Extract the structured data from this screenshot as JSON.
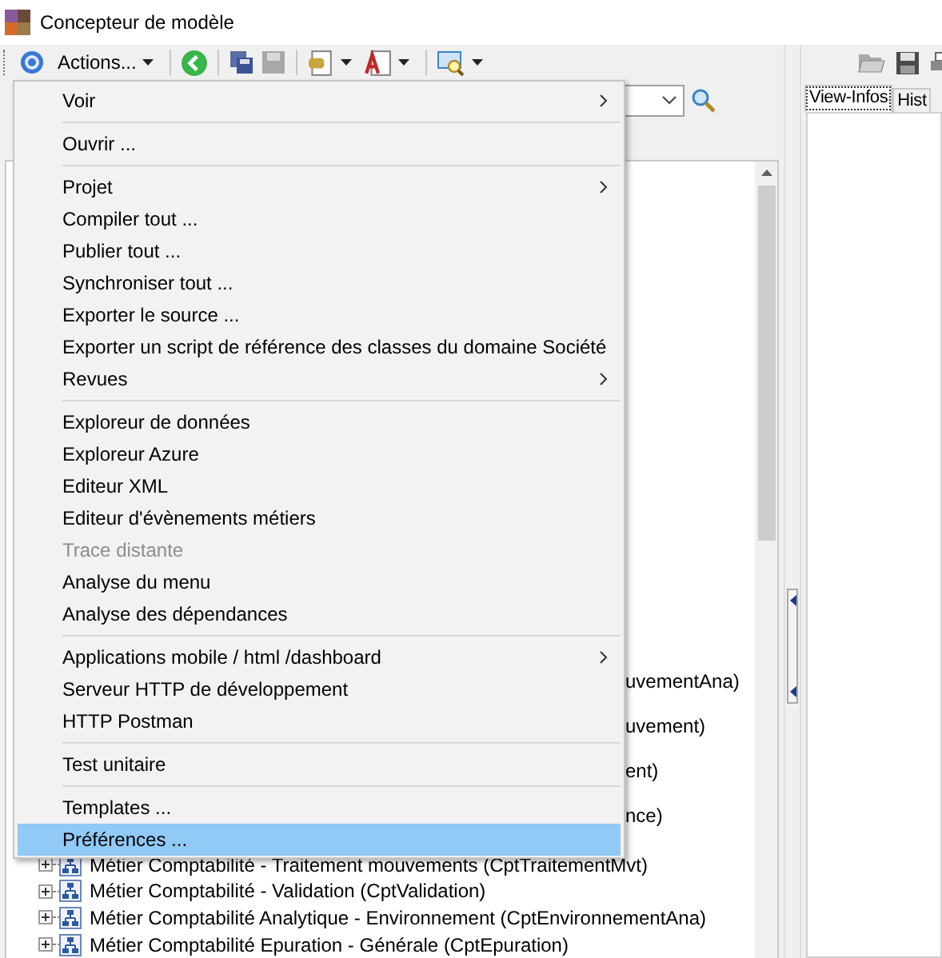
{
  "window": {
    "title": "Concepteur de modèle"
  },
  "toolbar": {
    "actions_label": "Actions..."
  },
  "tree": {
    "fragments": [
      {
        "label": "uvementAna)"
      },
      {
        "label": "uvement)"
      },
      {
        "label": "ent)"
      },
      {
        "label": "nce)"
      }
    ],
    "nodes": [
      {
        "label": "Métier Comptabilité - Traitement mouvements (CptTraitementMvt)"
      },
      {
        "label": "Métier Comptabilité - Validation (CptValidation)"
      },
      {
        "label": "Métier Comptabilité Analytique - Environnement (CptEnvironnementAna)"
      },
      {
        "label": "Métier Comptabilité Epuration - Générale (CptEpuration)"
      }
    ]
  },
  "side_panel": {
    "tabs": [
      {
        "label": "View-Infos",
        "selected": true
      },
      {
        "label": "Hist",
        "selected": false
      }
    ]
  },
  "menu": {
    "items": [
      {
        "kind": "item",
        "label": "Voir",
        "submenu": true,
        "disabled": false,
        "selected": false
      },
      {
        "kind": "separator"
      },
      {
        "kind": "item",
        "label": "Ouvrir ...",
        "submenu": false,
        "disabled": false,
        "selected": false
      },
      {
        "kind": "separator"
      },
      {
        "kind": "item",
        "label": "Projet",
        "submenu": true,
        "disabled": false,
        "selected": false
      },
      {
        "kind": "item",
        "label": "Compiler tout ...",
        "submenu": false,
        "disabled": false,
        "selected": false
      },
      {
        "kind": "item",
        "label": "Publier tout ...",
        "submenu": false,
        "disabled": false,
        "selected": false
      },
      {
        "kind": "item",
        "label": "Synchroniser tout ...",
        "submenu": false,
        "disabled": false,
        "selected": false
      },
      {
        "kind": "item",
        "label": "Exporter le source ...",
        "submenu": false,
        "disabled": false,
        "selected": false
      },
      {
        "kind": "item",
        "label": "Exporter un script de référence des classes du domaine Société",
        "submenu": false,
        "disabled": false,
        "selected": false
      },
      {
        "kind": "item",
        "label": "Revues",
        "submenu": true,
        "disabled": false,
        "selected": false
      },
      {
        "kind": "separator"
      },
      {
        "kind": "item",
        "label": "Exploreur de données",
        "submenu": false,
        "disabled": false,
        "selected": false
      },
      {
        "kind": "item",
        "label": "Exploreur Azure",
        "submenu": false,
        "disabled": false,
        "selected": false
      },
      {
        "kind": "item",
        "label": "Editeur XML",
        "submenu": false,
        "disabled": false,
        "selected": false
      },
      {
        "kind": "item",
        "label": "Editeur d'évènements métiers",
        "submenu": false,
        "disabled": false,
        "selected": false
      },
      {
        "kind": "item",
        "label": "Trace distante",
        "submenu": false,
        "disabled": true,
        "selected": false
      },
      {
        "kind": "item",
        "label": "Analyse du menu",
        "submenu": false,
        "disabled": false,
        "selected": false
      },
      {
        "kind": "item",
        "label": "Analyse des dépendances",
        "submenu": false,
        "disabled": false,
        "selected": false
      },
      {
        "kind": "separator"
      },
      {
        "kind": "item",
        "label": "Applications mobile / html /dashboard",
        "submenu": true,
        "disabled": false,
        "selected": false
      },
      {
        "kind": "item",
        "label": "Serveur HTTP de développement",
        "submenu": false,
        "disabled": false,
        "selected": false
      },
      {
        "kind": "item",
        "label": "HTTP Postman",
        "submenu": false,
        "disabled": false,
        "selected": false
      },
      {
        "kind": "separator"
      },
      {
        "kind": "item",
        "label": "Test unitaire",
        "submenu": false,
        "disabled": false,
        "selected": false
      },
      {
        "kind": "separator"
      },
      {
        "kind": "item",
        "label": "Templates ...",
        "submenu": false,
        "disabled": false,
        "selected": false
      },
      {
        "kind": "item",
        "label": "Préférences ...",
        "submenu": false,
        "disabled": false,
        "selected": true
      }
    ]
  }
}
